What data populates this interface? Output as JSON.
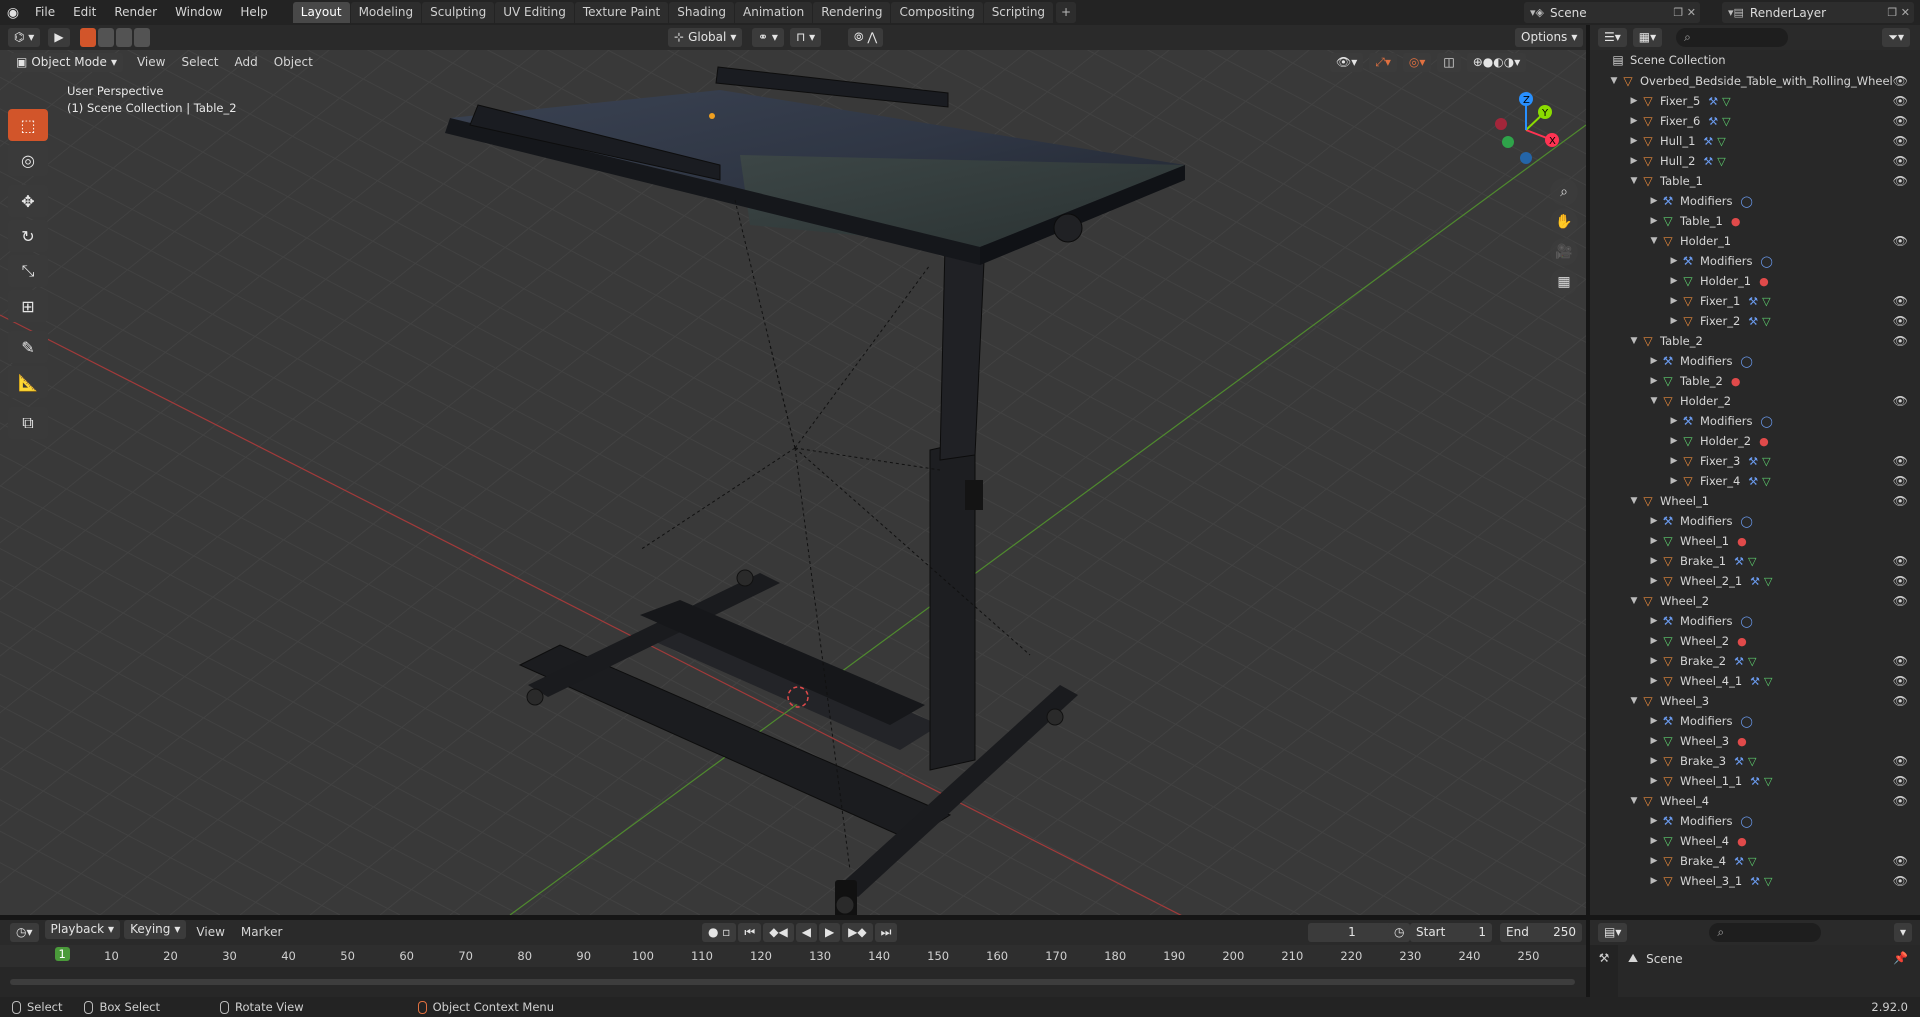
{
  "topbar": {
    "menus": [
      "File",
      "Edit",
      "Render",
      "Window",
      "Help"
    ],
    "workspaces": [
      "Layout",
      "Modeling",
      "Sculpting",
      "UV Editing",
      "Texture Paint",
      "Shading",
      "Animation",
      "Rendering",
      "Compositing",
      "Scripting"
    ],
    "active_workspace": "Layout",
    "add_tab": "+",
    "scene": "Scene",
    "view_layer": "RenderLayer"
  },
  "viewport": {
    "mode": "Object Mode",
    "menus": [
      "View",
      "Select",
      "Add",
      "Object"
    ],
    "transform_orientation": "Global",
    "options_label": "Options",
    "perspective_label": "User Perspective",
    "collection_label": "(1) Scene Collection | Table_2",
    "gizmo_axes": {
      "x": "X",
      "y": "Y",
      "z": "Z"
    }
  },
  "timeline": {
    "menus": [
      "Playback",
      "Keying",
      "View",
      "Marker"
    ],
    "current_frame": "1",
    "start_label": "Start",
    "start": "1",
    "end_label": "End",
    "end": "250",
    "ruler": [
      "1",
      "10",
      "20",
      "30",
      "40",
      "50",
      "60",
      "70",
      "80",
      "90",
      "100",
      "110",
      "120",
      "130",
      "140",
      "150",
      "160",
      "170",
      "180",
      "190",
      "200",
      "210",
      "220",
      "230",
      "240",
      "250"
    ]
  },
  "outliner": {
    "root": "Scene Collection",
    "rows": [
      {
        "label": "Overbed_Bedside_Table_with_Rolling_Wheel",
        "depth": 1,
        "type": "obj",
        "eye": true,
        "open": true
      },
      {
        "label": "Fixer_5",
        "depth": 2,
        "type": "obj",
        "eye": true,
        "extra": [
          "mod",
          "mesh"
        ]
      },
      {
        "label": "Fixer_6",
        "depth": 2,
        "type": "obj",
        "eye": true,
        "extra": [
          "mod",
          "mesh"
        ]
      },
      {
        "label": "Hull_1",
        "depth": 2,
        "type": "obj",
        "eye": true,
        "extra": [
          "mod",
          "mesh"
        ]
      },
      {
        "label": "Hull_2",
        "depth": 2,
        "type": "obj",
        "eye": true,
        "extra": [
          "mod",
          "mesh"
        ]
      },
      {
        "label": "Table_1",
        "depth": 2,
        "type": "obj",
        "eye": true,
        "open": true
      },
      {
        "label": "Modifiers",
        "depth": 3,
        "type": "mod",
        "extra": [
          "modwrench"
        ]
      },
      {
        "label": "Table_1",
        "depth": 3,
        "type": "mesh",
        "extra": [
          "mat"
        ]
      },
      {
        "label": "Holder_1",
        "depth": 3,
        "type": "obj",
        "eye": true,
        "open": true
      },
      {
        "label": "Modifiers",
        "depth": 4,
        "type": "mod",
        "extra": [
          "modwrench"
        ]
      },
      {
        "label": "Holder_1",
        "depth": 4,
        "type": "mesh",
        "extra": [
          "mat"
        ]
      },
      {
        "label": "Fixer_1",
        "depth": 4,
        "type": "obj",
        "eye": true,
        "extra": [
          "mod",
          "mesh"
        ]
      },
      {
        "label": "Fixer_2",
        "depth": 4,
        "type": "obj",
        "eye": true,
        "extra": [
          "mod",
          "mesh"
        ]
      },
      {
        "label": "Table_2",
        "depth": 2,
        "type": "obj",
        "eye": true,
        "open": true
      },
      {
        "label": "Modifiers",
        "depth": 3,
        "type": "mod",
        "extra": [
          "modwrench"
        ]
      },
      {
        "label": "Table_2",
        "depth": 3,
        "type": "mesh",
        "extra": [
          "mat"
        ]
      },
      {
        "label": "Holder_2",
        "depth": 3,
        "type": "obj",
        "eye": true,
        "open": true
      },
      {
        "label": "Modifiers",
        "depth": 4,
        "type": "mod",
        "extra": [
          "modwrench"
        ]
      },
      {
        "label": "Holder_2",
        "depth": 4,
        "type": "mesh",
        "extra": [
          "mat"
        ]
      },
      {
        "label": "Fixer_3",
        "depth": 4,
        "type": "obj",
        "eye": true,
        "extra": [
          "mod",
          "mesh"
        ]
      },
      {
        "label": "Fixer_4",
        "depth": 4,
        "type": "obj",
        "eye": true,
        "extra": [
          "mod",
          "mesh"
        ]
      },
      {
        "label": "Wheel_1",
        "depth": 2,
        "type": "obj",
        "eye": true,
        "open": true
      },
      {
        "label": "Modifiers",
        "depth": 3,
        "type": "mod",
        "extra": [
          "modwrench"
        ]
      },
      {
        "label": "Wheel_1",
        "depth": 3,
        "type": "mesh",
        "extra": [
          "mat"
        ]
      },
      {
        "label": "Brake_1",
        "depth": 3,
        "type": "obj",
        "eye": true,
        "extra": [
          "mod",
          "mesh"
        ]
      },
      {
        "label": "Wheel_2_1",
        "depth": 3,
        "type": "obj",
        "eye": true,
        "extra": [
          "mod",
          "mesh"
        ]
      },
      {
        "label": "Wheel_2",
        "depth": 2,
        "type": "obj",
        "eye": true,
        "open": true
      },
      {
        "label": "Modifiers",
        "depth": 3,
        "type": "mod",
        "extra": [
          "modwrench"
        ]
      },
      {
        "label": "Wheel_2",
        "depth": 3,
        "type": "mesh",
        "extra": [
          "mat"
        ]
      },
      {
        "label": "Brake_2",
        "depth": 3,
        "type": "obj",
        "eye": true,
        "extra": [
          "mod",
          "mesh"
        ]
      },
      {
        "label": "Wheel_4_1",
        "depth": 3,
        "type": "obj",
        "eye": true,
        "extra": [
          "mod",
          "mesh"
        ]
      },
      {
        "label": "Wheel_3",
        "depth": 2,
        "type": "obj",
        "eye": true,
        "open": true
      },
      {
        "label": "Modifiers",
        "depth": 3,
        "type": "mod",
        "extra": [
          "modwrench"
        ]
      },
      {
        "label": "Wheel_3",
        "depth": 3,
        "type": "mesh",
        "extra": [
          "mat"
        ]
      },
      {
        "label": "Brake_3",
        "depth": 3,
        "type": "obj",
        "eye": true,
        "extra": [
          "mod",
          "mesh"
        ]
      },
      {
        "label": "Wheel_1_1",
        "depth": 3,
        "type": "obj",
        "eye": true,
        "extra": [
          "mod",
          "mesh"
        ]
      },
      {
        "label": "Wheel_4",
        "depth": 2,
        "type": "obj",
        "eye": true,
        "open": true
      },
      {
        "label": "Modifiers",
        "depth": 3,
        "type": "mod",
        "extra": [
          "modwrench"
        ]
      },
      {
        "label": "Wheel_4",
        "depth": 3,
        "type": "mesh",
        "extra": [
          "mat"
        ]
      },
      {
        "label": "Brake_4",
        "depth": 3,
        "type": "obj",
        "eye": true,
        "extra": [
          "mod",
          "mesh"
        ]
      },
      {
        "label": "Wheel_3_1",
        "depth": 3,
        "type": "obj",
        "eye": true,
        "extra": [
          "mod",
          "mesh"
        ]
      }
    ]
  },
  "properties": {
    "scene_label": "Scene"
  },
  "statusbar": {
    "select": "Select",
    "box_select": "Box Select",
    "rotate_view": "Rotate View",
    "context_menu": "Object Context Menu",
    "version": "2.92.0"
  },
  "colors": {
    "accent": "#d2552a",
    "x_axis": "#ff3352",
    "y_axis": "#8bdc00",
    "z_axis": "#2890ff",
    "object": "#e8893b",
    "mesh": "#5fd16f",
    "modifier": "#6b9bef",
    "material": "#e04a4a"
  }
}
